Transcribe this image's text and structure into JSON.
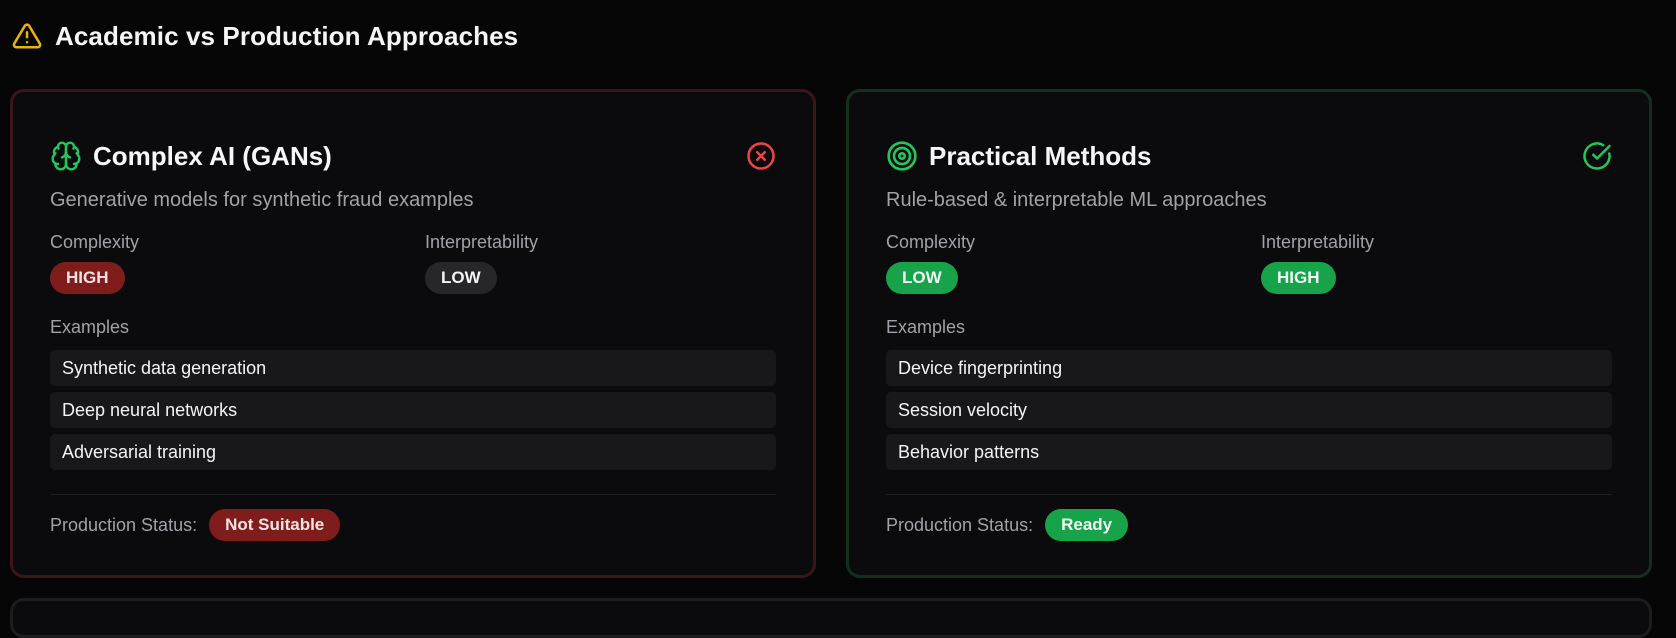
{
  "header": {
    "icon": "warning-icon",
    "title": "Academic vs Production Approaches"
  },
  "colors": {
    "warning": "#eab308",
    "danger": "#ef4444",
    "success": "#22c55e",
    "danger_pill": "#7f1d1d",
    "success_pill": "#16a34a",
    "neutral_pill": "#27272a"
  },
  "cards": [
    {
      "icon": "brain-icon",
      "status_icon": "x-circle-icon",
      "title": "Complex AI (GANs)",
      "subtitle": "Generative models for synthetic fraud examples",
      "complexity_label": "Complexity",
      "complexity_value": "HIGH",
      "interpretability_label": "Interpretability",
      "interpretability_value": "LOW",
      "examples_label": "Examples",
      "examples": [
        "Synthetic data generation",
        "Deep neural networks",
        "Adversarial training"
      ],
      "status_label": "Production Status:",
      "status_value": "Not Suitable"
    },
    {
      "icon": "target-icon",
      "status_icon": "check-circle-icon",
      "title": "Practical Methods",
      "subtitle": "Rule-based & interpretable ML approaches",
      "complexity_label": "Complexity",
      "complexity_value": "LOW",
      "interpretability_label": "Interpretability",
      "interpretability_value": "HIGH",
      "examples_label": "Examples",
      "examples": [
        "Device fingerprinting",
        "Session velocity",
        "Behavior patterns"
      ],
      "status_label": "Production Status:",
      "status_value": "Ready"
    }
  ]
}
